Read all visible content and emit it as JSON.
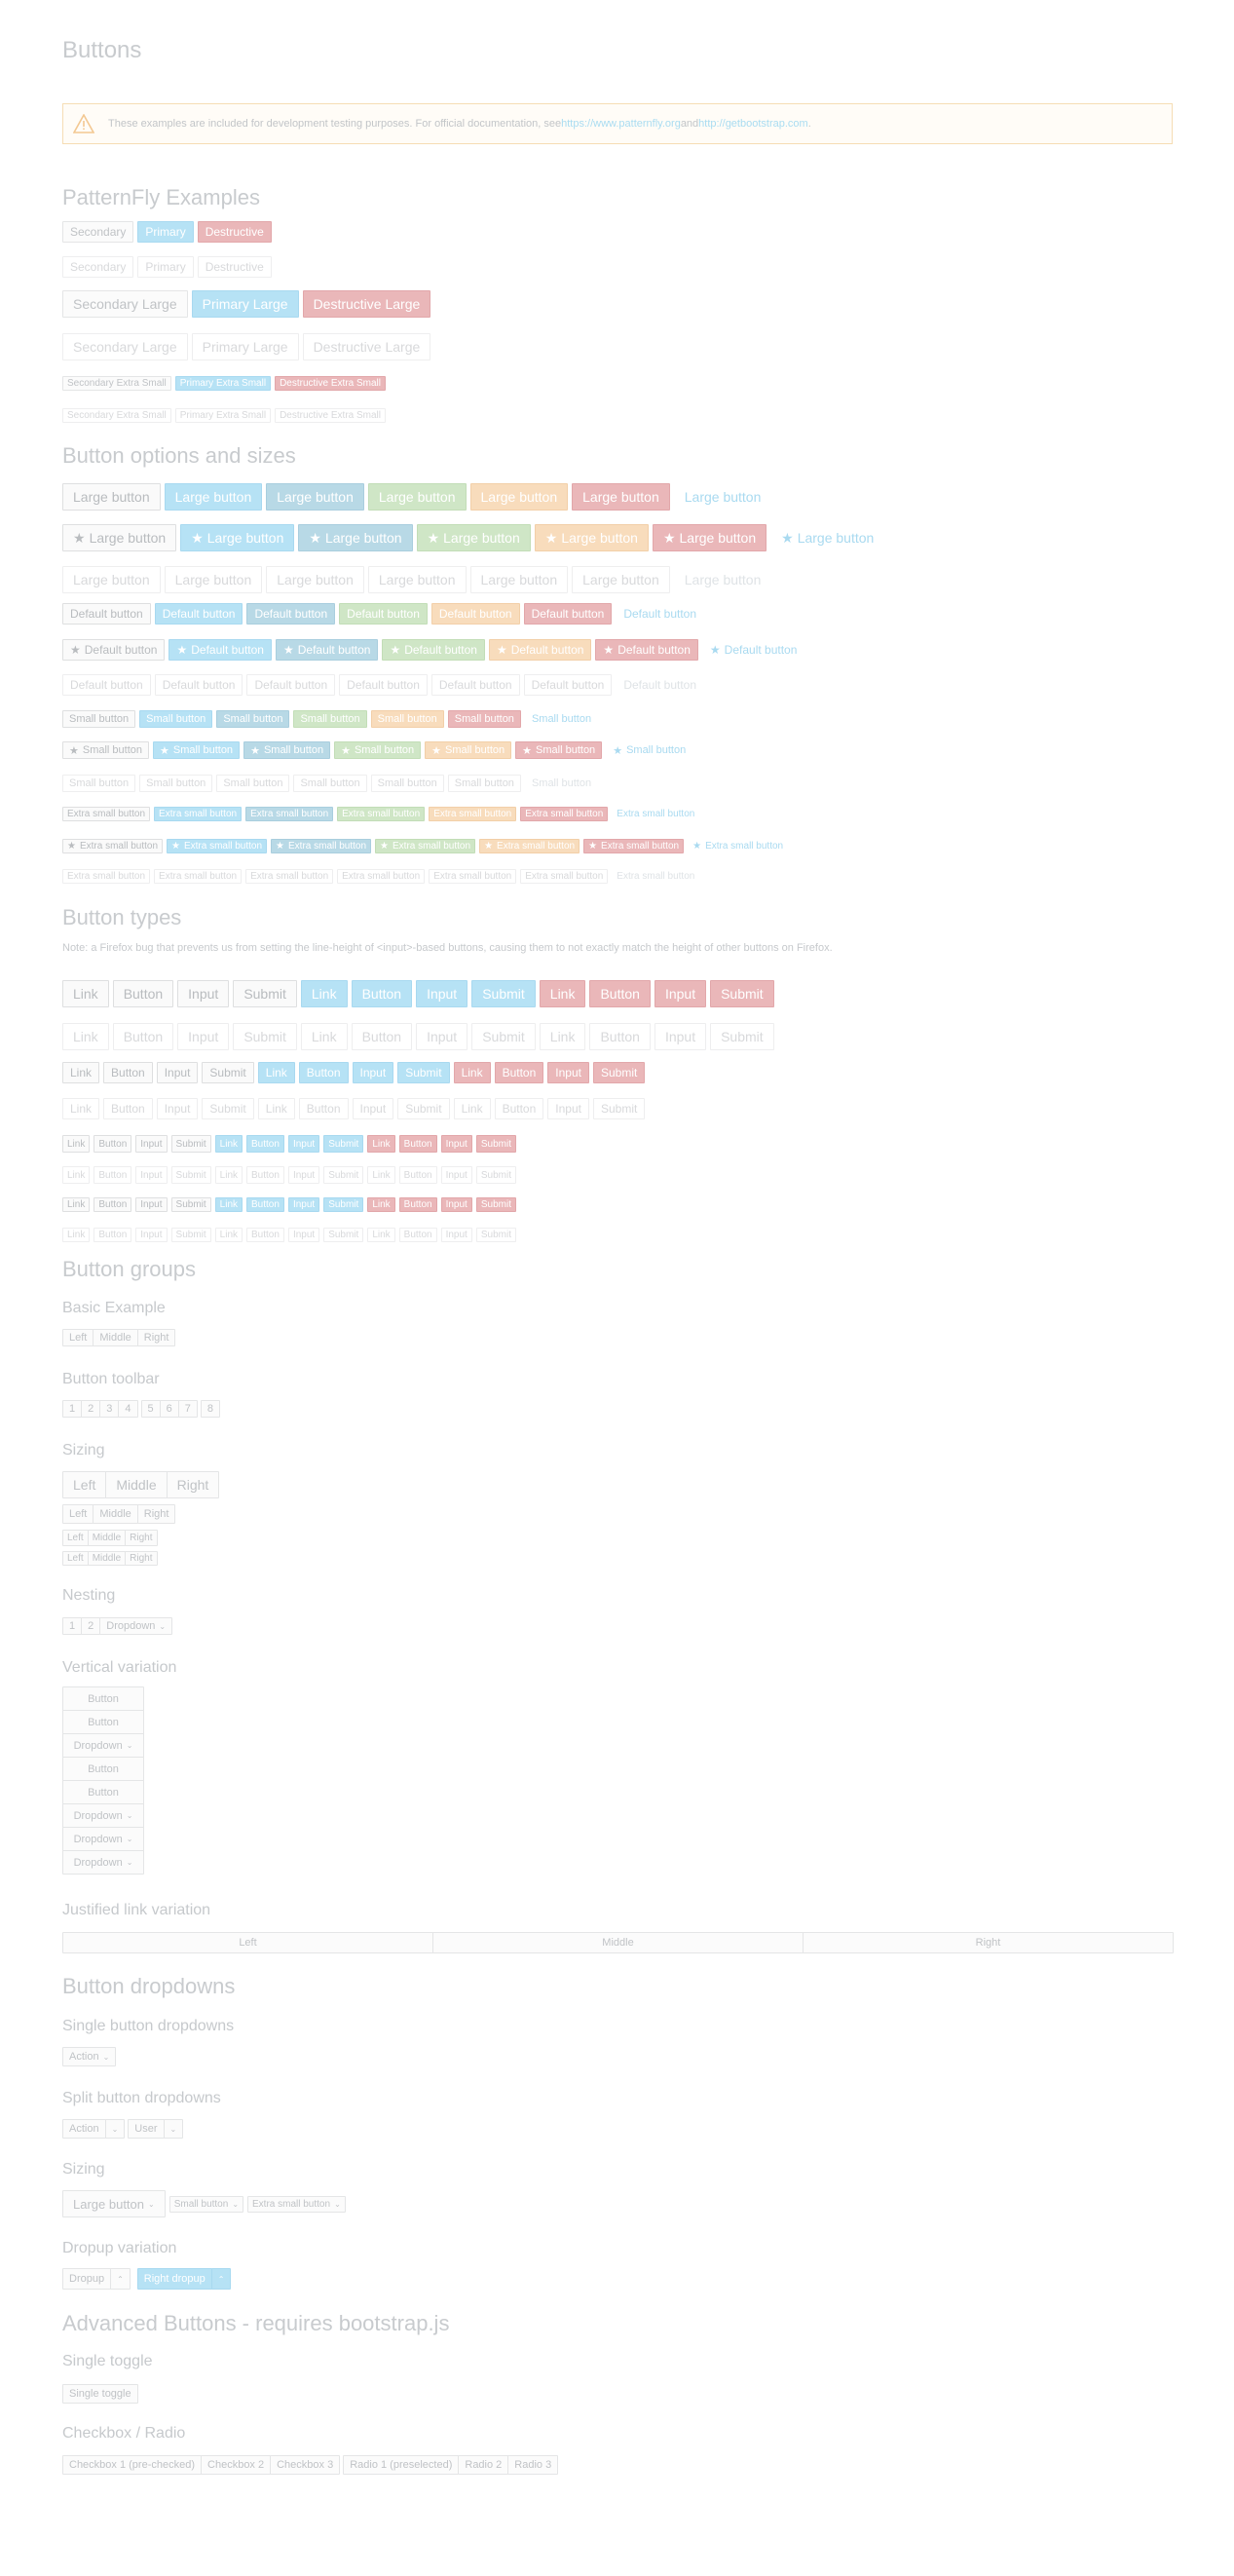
{
  "page_title": "Buttons",
  "alert": {
    "text": "These examples are included for development testing purposes. For official documentation, see ",
    "link1": "https://www.patternfly.org",
    "mid": " and ",
    "link2": "http://getbootstrap.com",
    "end": "."
  },
  "sections": {
    "pf": "PatternFly Examples",
    "options": "Button options and sizes",
    "types": "Button types",
    "types_note": "Note: a Firefox bug that prevents us from setting the line-height of <input>-based buttons, causing them to not exactly match the height of other buttons on Firefox.",
    "groups": "Button groups",
    "basic": "Basic Example",
    "toolbar": "Button toolbar",
    "sizing": "Sizing",
    "nesting": "Nesting",
    "vertical": "Vertical variation",
    "justified": "Justified link variation",
    "dropdowns": "Button dropdowns",
    "single_dd": "Single button dropdowns",
    "split_dd": "Split button dropdowns",
    "dd_sizing": "Sizing",
    "dropup": "Dropup variation",
    "advanced": "Advanced Buttons - requires bootstrap.js",
    "single_toggle": "Single toggle",
    "checkbox_radio": "Checkbox / Radio"
  },
  "pf": {
    "secondary": "Secondary",
    "primary": "Primary",
    "destructive": "Destructive",
    "secondary_lg": "Secondary Large",
    "primary_lg": "Primary Large",
    "destructive_lg": "Destructive Large",
    "secondary_xs": "Secondary Extra Small",
    "primary_xs": "Primary Extra Small",
    "destructive_xs": "Destructive Extra Small"
  },
  "sizes": {
    "large": "Large button",
    "default": "Default button",
    "small": "Small button",
    "xsmall": "Extra small button",
    "star": "★"
  },
  "types": {
    "link": "Link",
    "button": "Button",
    "input": "Input",
    "submit": "Submit"
  },
  "groups": {
    "left": "Left",
    "middle": "Middle",
    "right": "Right",
    "toolbar": [
      "1",
      "2",
      "3",
      "4",
      "5",
      "6",
      "7",
      "8"
    ],
    "one": "1",
    "two": "2",
    "dropdown": "Dropdown",
    "button": "Button"
  },
  "dropdowns": {
    "action": "Action",
    "user": "User",
    "large": "Large button",
    "small": "Small button",
    "xsmall": "Extra small button",
    "dropup": "Dropup",
    "right_dropup": "Right dropup",
    "caret": "⌄"
  },
  "advanced": {
    "single_toggle": "Single toggle",
    "cb1": "Checkbox 1 (pre-checked)",
    "cb2": "Checkbox 2",
    "cb3": "Checkbox 3",
    "r1": "Radio 1 (preselected)",
    "r2": "Radio 2",
    "r3": "Radio 3"
  },
  "colors": {
    "primary": "#b6e2f5",
    "info": "#b8d9e6",
    "success": "#cfe6c6",
    "warning": "#f8dcbc",
    "danger": "#eab7b9",
    "link": "#a9daf0"
  }
}
